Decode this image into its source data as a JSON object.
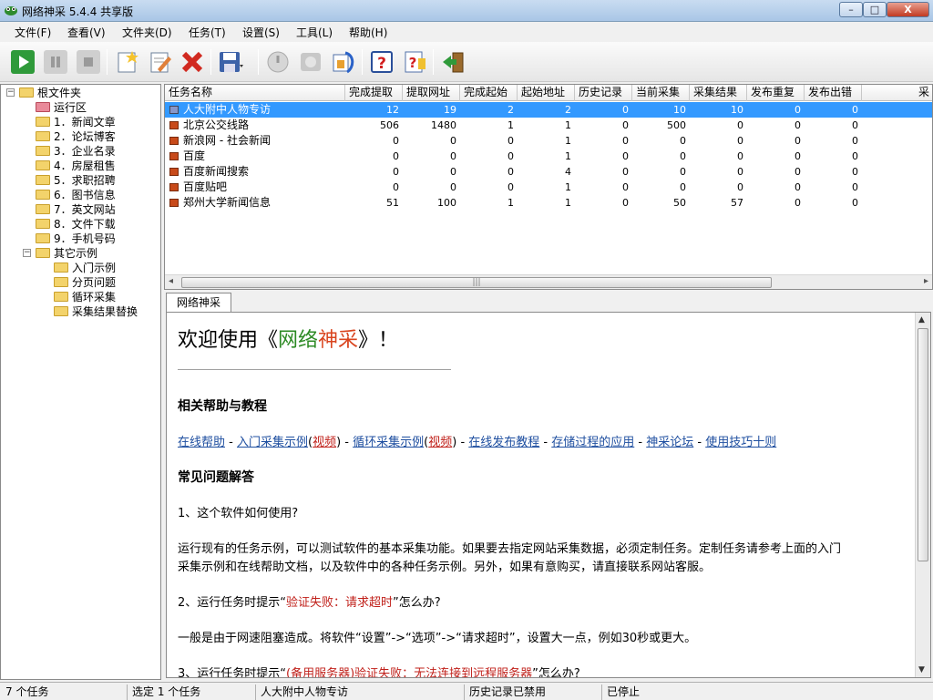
{
  "window": {
    "title": "网络神采 5.4.4 共享版",
    "minimize": "–",
    "maximize": "□",
    "close": "X"
  },
  "menu": [
    "文件(F)",
    "查看(V)",
    "文件夹(D)",
    "任务(T)",
    "设置(S)",
    "工具(L)",
    "帮助(H)"
  ],
  "toolbar": [
    "play-icon",
    "pause-icon",
    "stop-icon",
    "new-task-icon",
    "edit-task-icon",
    "delete-task-icon",
    "save-icon",
    "disabled-power-icon",
    "disabled-export-icon",
    "wizard-icon",
    "help-icon",
    "tips-icon",
    "exit-icon"
  ],
  "tree": {
    "root": "根文件夹",
    "items": [
      "运行区",
      "1．新闻文章",
      "2．论坛博客",
      "3．企业名录",
      "4．房屋租售",
      "5．求职招聘",
      "6．图书信息",
      "7．英文网站",
      "8．文件下载",
      "9．手机号码",
      "其它示例"
    ],
    "examples": [
      "入门示例",
      "分页问题",
      "循环采集",
      "采集结果替换"
    ]
  },
  "tasklist": {
    "columns": [
      "任务名称",
      "完成提取",
      "提取网址",
      "完成起始",
      "起始地址",
      "历史记录",
      "当前采集",
      "采集结果",
      "发布重复",
      "发布出错",
      "采"
    ],
    "rows": [
      {
        "name": "人大附中人物专访",
        "c": [
          "12",
          "19",
          "2",
          "2",
          "0",
          "10",
          "10",
          "0",
          "0"
        ]
      },
      {
        "name": "北京公交线路",
        "c": [
          "506",
          "1480",
          "1",
          "1",
          "0",
          "500",
          "0",
          "0",
          "0"
        ]
      },
      {
        "name": "新浪网 - 社会新闻",
        "c": [
          "0",
          "0",
          "0",
          "1",
          "0",
          "0",
          "0",
          "0",
          "0"
        ]
      },
      {
        "name": "百度",
        "c": [
          "0",
          "0",
          "0",
          "1",
          "0",
          "0",
          "0",
          "0",
          "0"
        ]
      },
      {
        "name": "百度新闻搜索",
        "c": [
          "0",
          "0",
          "0",
          "4",
          "0",
          "0",
          "0",
          "0",
          "0"
        ]
      },
      {
        "name": "百度贴吧",
        "c": [
          "0",
          "0",
          "0",
          "1",
          "0",
          "0",
          "0",
          "0",
          "0"
        ]
      },
      {
        "name": "郑州大学新闻信息",
        "c": [
          "51",
          "100",
          "1",
          "1",
          "0",
          "50",
          "57",
          "0",
          "0"
        ]
      }
    ],
    "scroll_left": "◂",
    "scroll_right": "▸"
  },
  "tab": "网络神采",
  "doc": {
    "welcome_pre": "欢迎使用《",
    "welcome_a": "网络",
    "welcome_b": "神采",
    "welcome_post": "》！",
    "help_heading": "相关帮助与教程",
    "links": {
      "l1": "在线帮助",
      "l2": "入门采集示例",
      "l2v": "视频",
      "l3": "循环采集示例",
      "l3v": "视频",
      "l4": "在线发布教程",
      "l5": "存储过程的应用",
      "l6": "神采论坛",
      "l7": "使用技巧十则"
    },
    "faq_heading": "常见问题解答",
    "q1": "1、这个软件如何使用?",
    "a1_line1": "运行现有的任务示例，可以测试软件的基本采集功能。如果要去指定网站采集数据，必须定制任务。定制任务请参考上面的入门",
    "a1_line2": "采集示例和在线帮助文档，以及软件中的各种任务示例。另外，如果有意购买，请直接联系网站客服。",
    "q2_pre": "2、运行任务时提示“",
    "q2_red": "验证失败：请求超时",
    "q2_post": "”怎么办?",
    "a2": "一般是由于网速阻塞造成。将软件“设置”->“选项”->“请求超时”，设置大一点，例如30秒或更大。",
    "q3_pre": "3、运行任务时提示“",
    "q3_red": "(备用服务器)验证失败：无法连接到远程服务器",
    "q3_post": "”怎么办?"
  },
  "status": [
    "7 个任务",
    "选定 1 个任务",
    "人大附中人物专访",
    "历史记录已禁用",
    "已停止"
  ]
}
